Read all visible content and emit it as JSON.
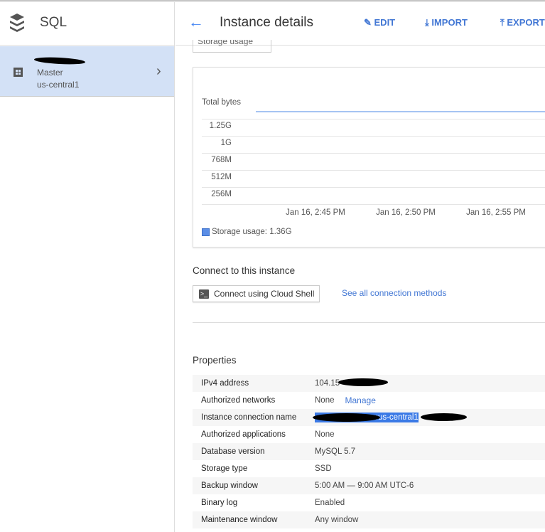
{
  "app": {
    "title": "SQL",
    "icon": "stack-layers-icon"
  },
  "sidebar": {
    "items": [
      {
        "role": "Master",
        "region": "us-central1",
        "icon": "instance-grid-icon"
      }
    ]
  },
  "header": {
    "title": "Instance details",
    "buttons": [
      {
        "label": "EDIT",
        "icon": "pencil-icon"
      },
      {
        "label": "IMPORT",
        "icon": "import-icon"
      },
      {
        "label": "EXPORT",
        "icon": "export-icon"
      }
    ]
  },
  "metric_dropdown": {
    "value": "Storage usage"
  },
  "chart_data": {
    "type": "line",
    "ylabel": "Total bytes",
    "yticks": [
      "1.25G",
      "1G",
      "768M",
      "512M",
      "256M"
    ],
    "xticks": [
      "Jan 16, 2:45 PM",
      "Jan 16, 2:50 PM",
      "Jan 16, 2:55 PM"
    ],
    "series": [
      {
        "name": "Storage usage",
        "value_label": "1.36G",
        "color": "#5b8ee6"
      }
    ],
    "legend": "Storage usage: 1.36G",
    "grid": true,
    "legend_position": "bottom-left"
  },
  "connect": {
    "heading": "Connect to this instance",
    "cloud_shell_label": "Connect using Cloud Shell",
    "all_methods_link": "See all connection methods"
  },
  "properties": {
    "heading": "Properties",
    "rows": [
      {
        "key": "IPv4 address",
        "value": "104.15"
      },
      {
        "key": "Authorized networks",
        "value": "None",
        "link": "Manage"
      },
      {
        "key": "Instance connection name",
        "value": "s:us-central1"
      },
      {
        "key": "Authorized applications",
        "value": "None"
      },
      {
        "key": "Database version",
        "value": "MySQL 5.7"
      },
      {
        "key": "Storage type",
        "value": "SSD"
      },
      {
        "key": "Backup window",
        "value": "5:00 AM — 9:00 AM UTC-6"
      },
      {
        "key": "Binary log",
        "value": "Enabled"
      },
      {
        "key": "Maintenance window",
        "value": "Any window"
      }
    ]
  }
}
